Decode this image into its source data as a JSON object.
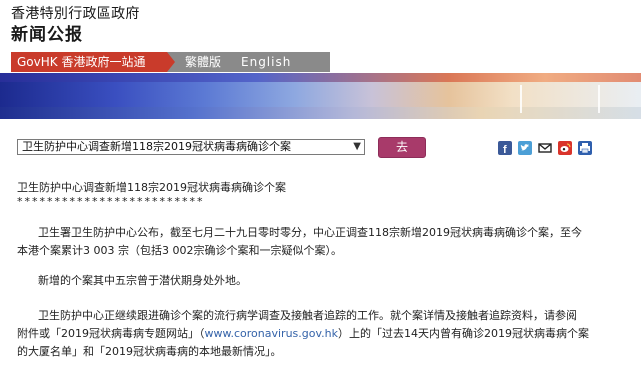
{
  "header": {
    "subtitle": "香港特別行政區政府",
    "title": "新闻公报"
  },
  "nav": {
    "govhk": "GovHK 香港政府一站通",
    "traditional": "繁體版",
    "english": "English"
  },
  "selector": {
    "selected": "卫生防护中心调查新增118宗2019冠状病毒病确诊个案",
    "go_label": "去"
  },
  "share": [
    "facebook-icon",
    "twitter-icon",
    "email-icon",
    "weibo-icon",
    "print-icon"
  ],
  "article": {
    "title": "卫生防护中心调查新增118宗2019冠状病毒病确诊个案",
    "stars": "*************************",
    "p1_line1": "卫生署卫生防护中心公布，截至七月二十九日零时零分，中心正调查118宗新增2019冠状病毒病确诊个案，至今",
    "p1_line2": "本港个案累计3 003 宗（包括3 002宗确诊个案和一宗疑似个案）。",
    "p2": "新增的个案其中五宗曾于潜伏期身处外地。",
    "p3_line1": "卫生防护中心正继续跟进确诊个案的流行病学调查及接触者追踪的工作。就个案详情及接触者追踪资料，请参阅",
    "p3_line2_a": "附件或「2019冠状病毒病专题网站」（",
    "p3_link": "www.coronavirus.gov.hk",
    "p3_line2_b": "）上的「过去14天内曾有确诊2019冠状病毒病个案",
    "p3_line3": "的大厦名单」和「2019冠状病毒病的本地最新情况」。"
  }
}
